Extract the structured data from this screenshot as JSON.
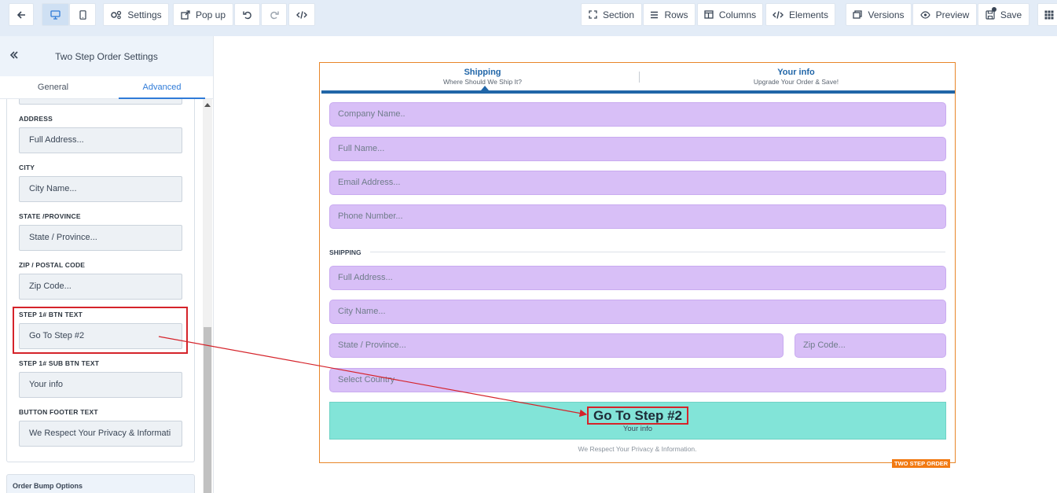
{
  "toolbar": {
    "settings": "Settings",
    "popup": "Pop up",
    "section": "Section",
    "rows": "Rows",
    "columns": "Columns",
    "elements": "Elements",
    "versions": "Versions",
    "preview": "Preview",
    "save": "Save"
  },
  "panel": {
    "title": "Two Step Order Settings",
    "tabs": [
      "General",
      "Advanced"
    ],
    "fields": [
      {
        "label": "ADDRESS",
        "value": "Full Address..."
      },
      {
        "label": "CITY",
        "value": "City Name..."
      },
      {
        "label": "STATE /PROVINCE",
        "value": "State / Province..."
      },
      {
        "label": "ZIP / POSTAL CODE",
        "value": "Zip Code..."
      },
      {
        "label": "STEP 1# BTN TEXT",
        "value": "Go To Step #2"
      },
      {
        "label": "STEP 1# SUB BTN TEXT",
        "value": "Your info"
      },
      {
        "label": "BUTTON FOOTER TEXT",
        "value": "We Respect Your Privacy & Informati"
      }
    ],
    "order_bump": "Order Bump Options"
  },
  "form": {
    "steps": [
      {
        "title": "Shipping",
        "subtitle": "Where Should We Ship It?"
      },
      {
        "title": "Your info",
        "subtitle": "Upgrade Your Order & Save!"
      }
    ],
    "inputs": {
      "company": "Company Name..",
      "full_name": "Full Name...",
      "email": "Email Address...",
      "phone": "Phone Number...",
      "address": "Full Address...",
      "city": "City Name...",
      "state": "State / Province...",
      "zip": "Zip Code...",
      "country": "Select Country"
    },
    "shipping_label": "SHIPPING",
    "button_text": "Go To Step #2",
    "button_sub": "Your info",
    "footer": "We Respect Your Privacy & Information.",
    "badge": "TWO STEP ORDER"
  },
  "colors": {
    "accent": "#2166a8",
    "input_bg": "#d8bff7",
    "button_bg": "#82e4d8",
    "annotation": "#d5232a",
    "badge": "#f27a12"
  }
}
